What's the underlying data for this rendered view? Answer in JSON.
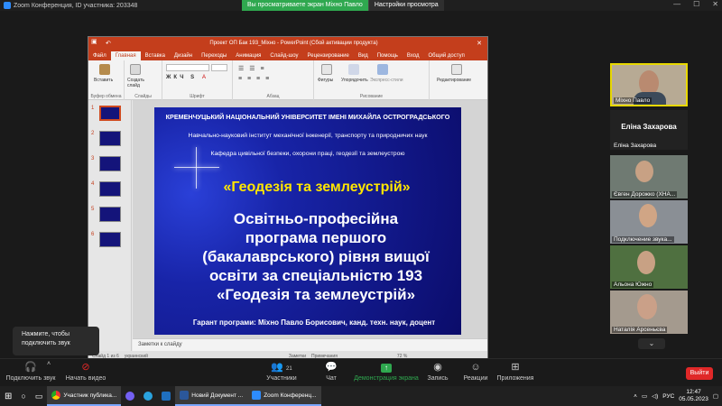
{
  "zoom": {
    "window_title": "Zoom Конференция, ID участника: 203348",
    "share_notice": "Вы просматриваете экран Міхно Павло",
    "view_options": "Настройки просмотра"
  },
  "ppt": {
    "title": "Проект ОП Бак 193_Міхно - PowerPoint (Сбой активации продукта)",
    "tabs": [
      "Файл",
      "Главная",
      "Вставка",
      "Дизайн",
      "Переходы",
      "Анимация",
      "Слайд-шоу",
      "Рецензирование",
      "Вид",
      "Помощь",
      "Вход",
      "Общий доступ"
    ],
    "active_tab": "Главная",
    "ribbon": {
      "paste": "Вставить",
      "create_slide": "Создать слайд",
      "clipboard": "Буфер обмена",
      "slides": "Слайды",
      "font": "Шрифт",
      "paragraph": "Абзац",
      "figures": "Фигуры",
      "arrange": "Упорядочить",
      "express": "Экспресс-стили",
      "drawing": "Рисование",
      "editing": "Редактирование"
    },
    "thumb_numbers": [
      "1",
      "2",
      "3",
      "4",
      "5",
      "6"
    ],
    "slide": {
      "university": "КРЕМЕНЧУЦЬКИЙ НАЦІОНАЛЬНИЙ УНІВЕРСИТЕТ ІМЕНІ МИХАЙЛА ОСТРОГРАДСЬКОГО",
      "institute": "Навчально-науковий інститут механічної інженерії, транспорту та природничих наук",
      "department": "Кафедра цивільної безпеки, охорони праці, геодезії та землеустрою",
      "program": "«Геодезія та землеустрій»",
      "main_lines": [
        "Освітньо-професійна",
        "програма першого",
        "(бакалаврського) рівня вищої",
        "освіти за спеціальністю 193",
        "«Геодезія та землеустрій»"
      ],
      "guarantor": "Гарант програми: Міхно Павло Борисович, канд. техн. наук, доцент"
    },
    "notes": "Заметки к слайду",
    "status": {
      "slide": "Слайд 1 из 6",
      "lang": "украинский",
      "notes": "Заметки",
      "comments": "Примечания",
      "zoom": "72 %"
    }
  },
  "participants": [
    {
      "name": "Міхно Павло",
      "type": "video",
      "highlight": true
    },
    {
      "name": "Еліна Захарова",
      "type": "name"
    },
    {
      "name": "Євген Дорожко (ХНА...",
      "type": "video"
    },
    {
      "name": "Подключение звука...",
      "type": "video"
    },
    {
      "name": "Альона Южно",
      "type": "video"
    },
    {
      "name": "Наталія Арсеньєва",
      "type": "video"
    }
  ],
  "tooltip": "Нажмите, чтобы подключить звук",
  "toolbar": {
    "audio": "Подключить звук",
    "video": "Начать видео",
    "participants": "Участники",
    "participants_count": "21",
    "chat": "Чат",
    "share": "Демонстрация экрана",
    "record": "Запись",
    "reactions": "Реакции",
    "apps": "Приложения",
    "leave": "Выйти"
  },
  "taskbar": {
    "chrome": "Участник публика...",
    "word": "Новий Документ ...",
    "zoom": "Zoom Конференц...",
    "lang": "РУС",
    "time": "12:47",
    "date": "05.05.2023"
  },
  "colors": {
    "ppt_accent": "#c43e1c",
    "zoom_share": "#2fa84f",
    "leave": "#e02828",
    "highlight": "#e8d800"
  }
}
